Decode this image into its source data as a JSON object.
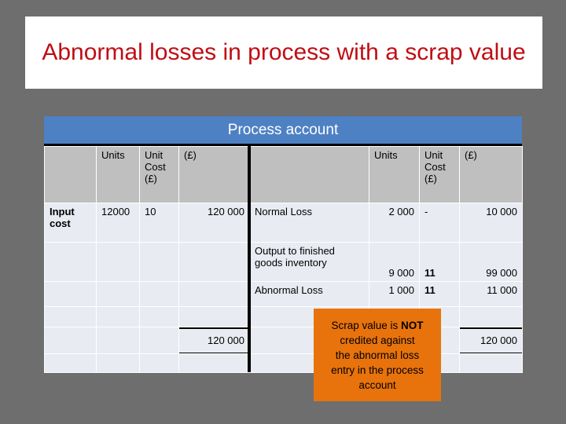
{
  "slide": {
    "title": "Abnormal losses in process with a scrap value",
    "title_color": "#c00d14",
    "background_color": "#6e6e6e"
  },
  "table": {
    "account_title": "Process account",
    "accent_color": "#4e81c3",
    "header_fill": "#bfbfbf",
    "cell_fill": "#e8ebf1",
    "debit_headers": {
      "description": "",
      "units": "Units",
      "unit_cost": "Unit Cost (£)",
      "amount": "(£)"
    },
    "credit_headers": {
      "description": "",
      "units": "Units",
      "unit_cost": "Unit Cost (£)",
      "amount": "(£)"
    },
    "debit_rows": [
      {
        "description": "Input cost",
        "units": "12000",
        "unit_cost": "10",
        "amount": "120 000"
      },
      {
        "description": "",
        "units": "",
        "unit_cost": "",
        "amount": ""
      },
      {
        "description": "",
        "units": "",
        "unit_cost": "",
        "amount": ""
      },
      {
        "description": "",
        "units": "",
        "unit_cost": "",
        "amount": ""
      }
    ],
    "credit_rows": [
      {
        "description": "Normal Loss",
        "units": "2 000",
        "unit_cost": "-",
        "amount": "10 000"
      },
      {
        "description": "Output to finished goods inventory",
        "units": "9 000",
        "unit_cost": "11",
        "amount": "99 000"
      },
      {
        "description": "Abnormal Loss",
        "units": "1 000",
        "unit_cost": "11",
        "amount": "11 000"
      },
      {
        "description": "",
        "units": "",
        "unit_cost": "",
        "amount": ""
      }
    ],
    "debit_total": "120 000",
    "credit_total": "120 000"
  },
  "callout": {
    "background_color": "#e8730c",
    "line1_before": "Scrap value is ",
    "line1_emphasis": "NOT",
    "line2": "credited against",
    "line3": "the abnormal loss",
    "line4": "entry in the process",
    "line5": "account"
  }
}
